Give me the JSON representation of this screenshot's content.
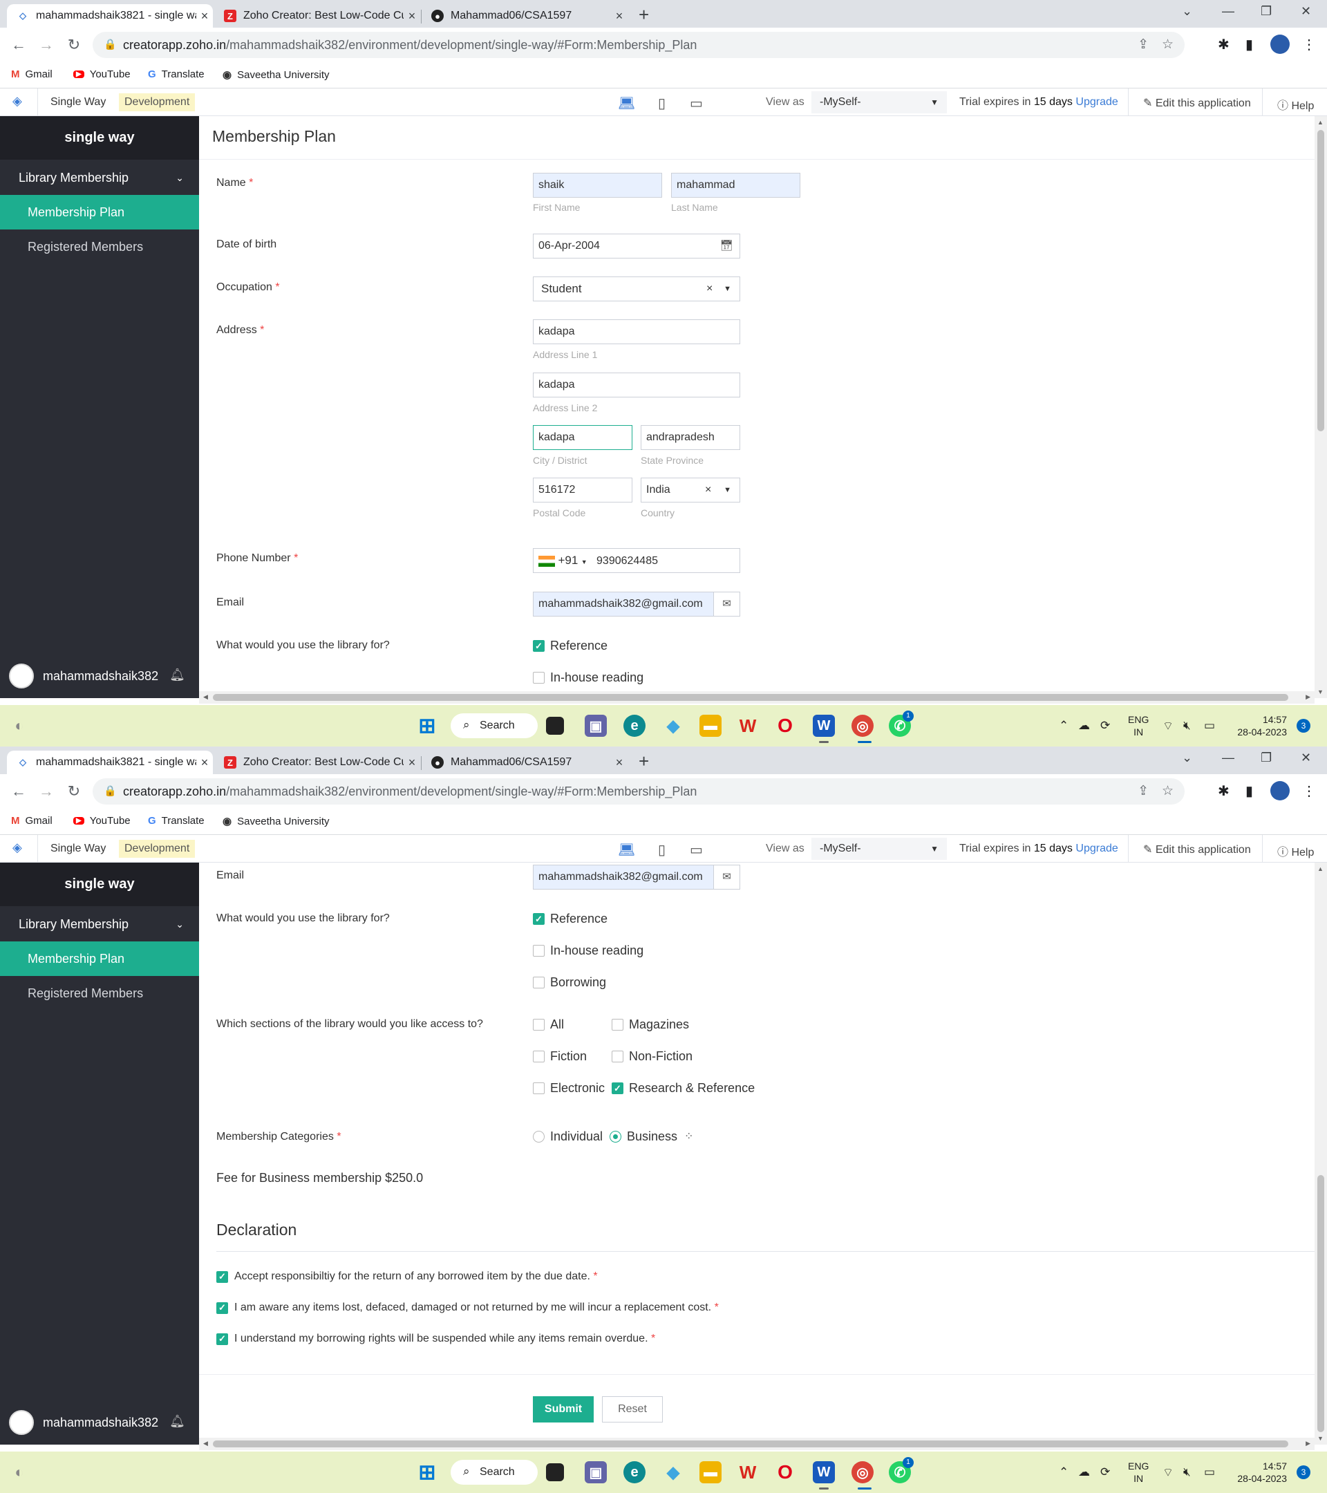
{
  "browser": {
    "tabs": [
      {
        "title": "mahammadshaik3821 - single way",
        "active": true
      },
      {
        "title": "Zoho Creator: Best Low-Code Cu",
        "active": false
      },
      {
        "title": "Mahammad06/CSA1597",
        "active": false
      }
    ],
    "url_host": "creatorapp.zoho.in",
    "url_path": "/mahammadshaik382/environment/development/single-way/#Form:Membership_Plan",
    "bookmarks": [
      "Gmail",
      "YouTube",
      "Translate",
      "Saveetha University"
    ]
  },
  "app_header": {
    "app_label": "Single Way",
    "env_badge": "Development",
    "view_as_label": "View as",
    "view_as_value": "-MySelf-",
    "trial_prefix": "Trial expires in",
    "trial_days": "15 days",
    "upgrade": "Upgrade",
    "edit_app": "Edit this application",
    "help": "Help"
  },
  "sidebar": {
    "app_name": "single way",
    "section": "Library Membership",
    "items": [
      "Membership Plan",
      "Registered Members"
    ],
    "user": "mahammadshaik382"
  },
  "form": {
    "title": "Membership Plan",
    "name_label": "Name",
    "first_name": "shaik",
    "first_name_sub": "First Name",
    "last_name": "mahammad",
    "last_name_sub": "Last Name",
    "dob_label": "Date of birth",
    "dob": "06-Apr-2004",
    "occupation_label": "Occupation",
    "occupation": "Student",
    "address_label": "Address",
    "address_line1": "kadapa",
    "address_line1_sub": "Address Line 1",
    "address_line2": "kadapa",
    "address_line2_sub": "Address Line 2",
    "city": "kadapa",
    "city_sub": "City / District",
    "state": "andrapradesh",
    "state_sub": "State Province",
    "postal": "516172",
    "postal_sub": "Postal Code",
    "country": "India",
    "country_sub": "Country",
    "phone_label": "Phone Number",
    "phone_code": "+91",
    "phone": "9390624485",
    "email_label": "Email",
    "email": "mahammadshaik382@gmail.com",
    "use_label": "What would you use the library for?",
    "use_options": [
      {
        "label": "Reference",
        "checked": true
      },
      {
        "label": "In-house reading",
        "checked": false
      },
      {
        "label": "Borrowing",
        "checked": false
      }
    ],
    "sections_label": "Which sections of the library would you like access to?",
    "sections_options": [
      {
        "label": "All",
        "checked": false
      },
      {
        "label": "Magazines",
        "checked": false
      },
      {
        "label": "Fiction",
        "checked": false
      },
      {
        "label": "Non-Fiction",
        "checked": false
      },
      {
        "label": "Electronic",
        "checked": false
      },
      {
        "label": "Research & Reference",
        "checked": true
      }
    ],
    "categories_label": "Membership Categories",
    "categories": [
      {
        "label": "Individual",
        "selected": false
      },
      {
        "label": "Business",
        "selected": true
      }
    ],
    "fee_text": "Fee for Business membership $250.0",
    "declaration_title": "Declaration",
    "declarations": [
      "Accept responsibiltiy for the return of any borrowed item by the due date.",
      "I am aware any items lost, defaced, damaged or not returned by me will incur a replacement cost.",
      "I understand my borrowing rights will be suspended while any items remain overdue."
    ],
    "submit": "Submit",
    "reset": "Reset"
  },
  "taskbar": {
    "search": "Search",
    "lang_top": "ENG",
    "lang_bottom": "IN",
    "time": "14:57",
    "date": "28-04-2023",
    "notifications": "3",
    "whatsapp_badge": "1"
  },
  "colors": {
    "accent": "#1dae8f",
    "sidebar_bg": "#2b2d35",
    "taskbar_bg": "#e9f2c8"
  }
}
